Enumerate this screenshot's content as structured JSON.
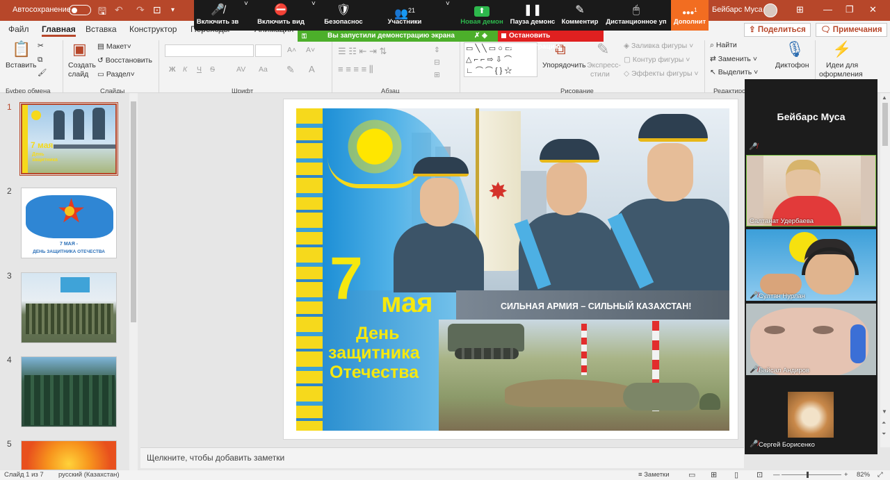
{
  "titlebar": {
    "autosave_label": "Автосохранение",
    "autosave_state": "off",
    "user_name": "Бейбарс Муса",
    "bg_color": "#b7472a"
  },
  "zoom": {
    "mute_label": "Включить зв",
    "video_label": "Включить вид",
    "security_label": "Безопаснос",
    "participants_label": "Участники",
    "participants_count": "21",
    "new_share_label": "Новая демон",
    "pause_share_label": "Пауза демонс",
    "annotate_label": "Комментир",
    "remote_label": "Дистанционное уп",
    "more_label": "Дополнит",
    "more_badge": "1",
    "sharing_banner": "Вы запустили демонстрацию экрана",
    "stop_share_label": "Остановить демонстрацию"
  },
  "tabs": [
    "Файл",
    "Главная",
    "Вставка",
    "Конструктор",
    "Переходы",
    "Анимация"
  ],
  "active_tab": "Главная",
  "share_button": "Поделиться",
  "comments_button": "Примечания",
  "ribbon": {
    "clipboard": {
      "paste": "Вставить",
      "group": "Буфер обмена"
    },
    "slides": {
      "new_slide_line1": "Создать",
      "new_slide_line2": "слайд",
      "layout": "Макет",
      "reset": "Восстановить",
      "section": "Раздел",
      "group": "Слайды"
    },
    "font": {
      "group": "Шрифт",
      "bold": "Ж",
      "italic": "К",
      "underline": "Ч",
      "strike": "S",
      "spacing": "AV",
      "case": "Aa"
    },
    "paragraph": {
      "group": "Абзац"
    },
    "drawing": {
      "arrange": "Упорядочить",
      "quick_styles_line1": "Экспресс-",
      "quick_styles_line2": "стили",
      "fill": "Заливка фигуры",
      "outline": "Контур фигуры",
      "effects": "Эффекты фигуры",
      "group": "Рисование"
    },
    "editing": {
      "find": "Найти",
      "replace": "Заменить",
      "select": "Выделить",
      "group": "Редактиров"
    },
    "voice": {
      "dictate": "Диктофон"
    },
    "designer": {
      "line1": "Идеи для",
      "line2": "оформления"
    }
  },
  "thumbnails": [
    {
      "num": "1",
      "title": "7 мая",
      "subtitle": "День защитника",
      "selected": true
    },
    {
      "num": "2",
      "caption_line1": "7 МАЯ -",
      "caption_line2": "ДЕНЬ ЗАЩИТНИКА ОТЕЧЕСТВА"
    },
    {
      "num": "3"
    },
    {
      "num": "4"
    },
    {
      "num": "5"
    }
  ],
  "slide": {
    "date_big": "7",
    "date_month": "мая",
    "line1": "День",
    "line2": "защитника",
    "line3": "Отечества",
    "slogan": "СИЛЬНАЯ АРМИЯ – СИЛЬНЫЙ КАЗАХСТАН!"
  },
  "notes_placeholder": "Щелкните, чтобы добавить заметки",
  "participants_panel": {
    "host_name": "Бейбарс Муса",
    "tiles": [
      {
        "name": "Салтанат Удербаева",
        "muted": false
      },
      {
        "name": "Султан Нурлан",
        "muted": true
      },
      {
        "name": "Байсал Андиров",
        "muted": true
      },
      {
        "name": "Сергей Борисенко",
        "muted": true
      }
    ]
  },
  "status": {
    "slide_info": "Слайд 1 из 7",
    "language": "русский (Казахстан)",
    "notes": "Заметки",
    "zoom_level": "82%"
  }
}
